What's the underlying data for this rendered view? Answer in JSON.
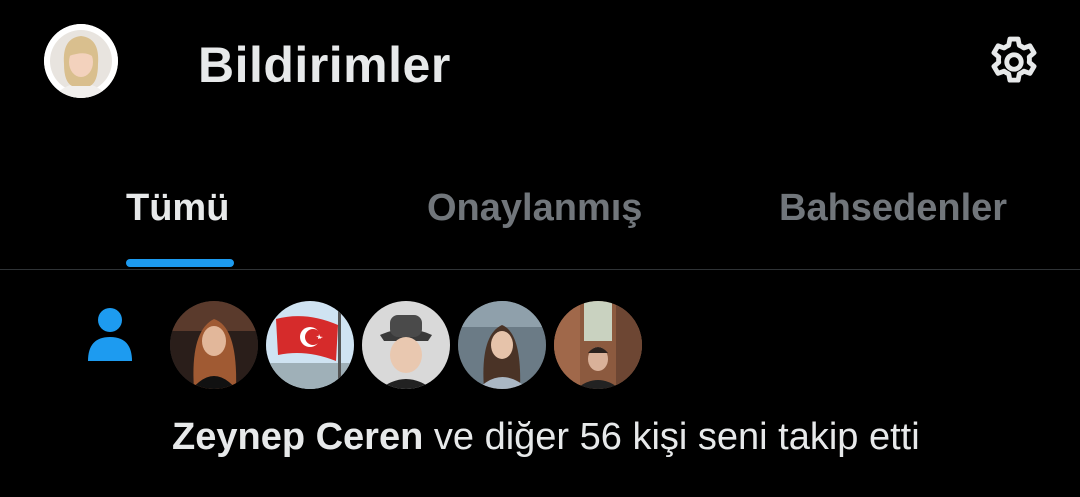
{
  "header": {
    "title": "Bildirimler",
    "avatar_icon": "profile-avatar",
    "settings_icon": "gear-icon"
  },
  "tabs": [
    {
      "label": "Tümü",
      "active": true
    },
    {
      "label": "Onaylanmış",
      "active": false
    },
    {
      "label": "Bahsedenler",
      "active": false
    }
  ],
  "notification": {
    "type_icon": "person-icon",
    "name": "Zeynep Ceren",
    "text": "ve diğer 56 kişi seni takip etti",
    "avatars": [
      "avatar-woman-red-hair",
      "avatar-turkish-flag",
      "avatar-boy-hat",
      "avatar-woman-car",
      "avatar-man-street"
    ]
  },
  "colors": {
    "background": "#000000",
    "primary_text": "#e7e9ea",
    "secondary_text": "#71767b",
    "accent": "#1d9bf0",
    "divider": "#2f3336"
  }
}
